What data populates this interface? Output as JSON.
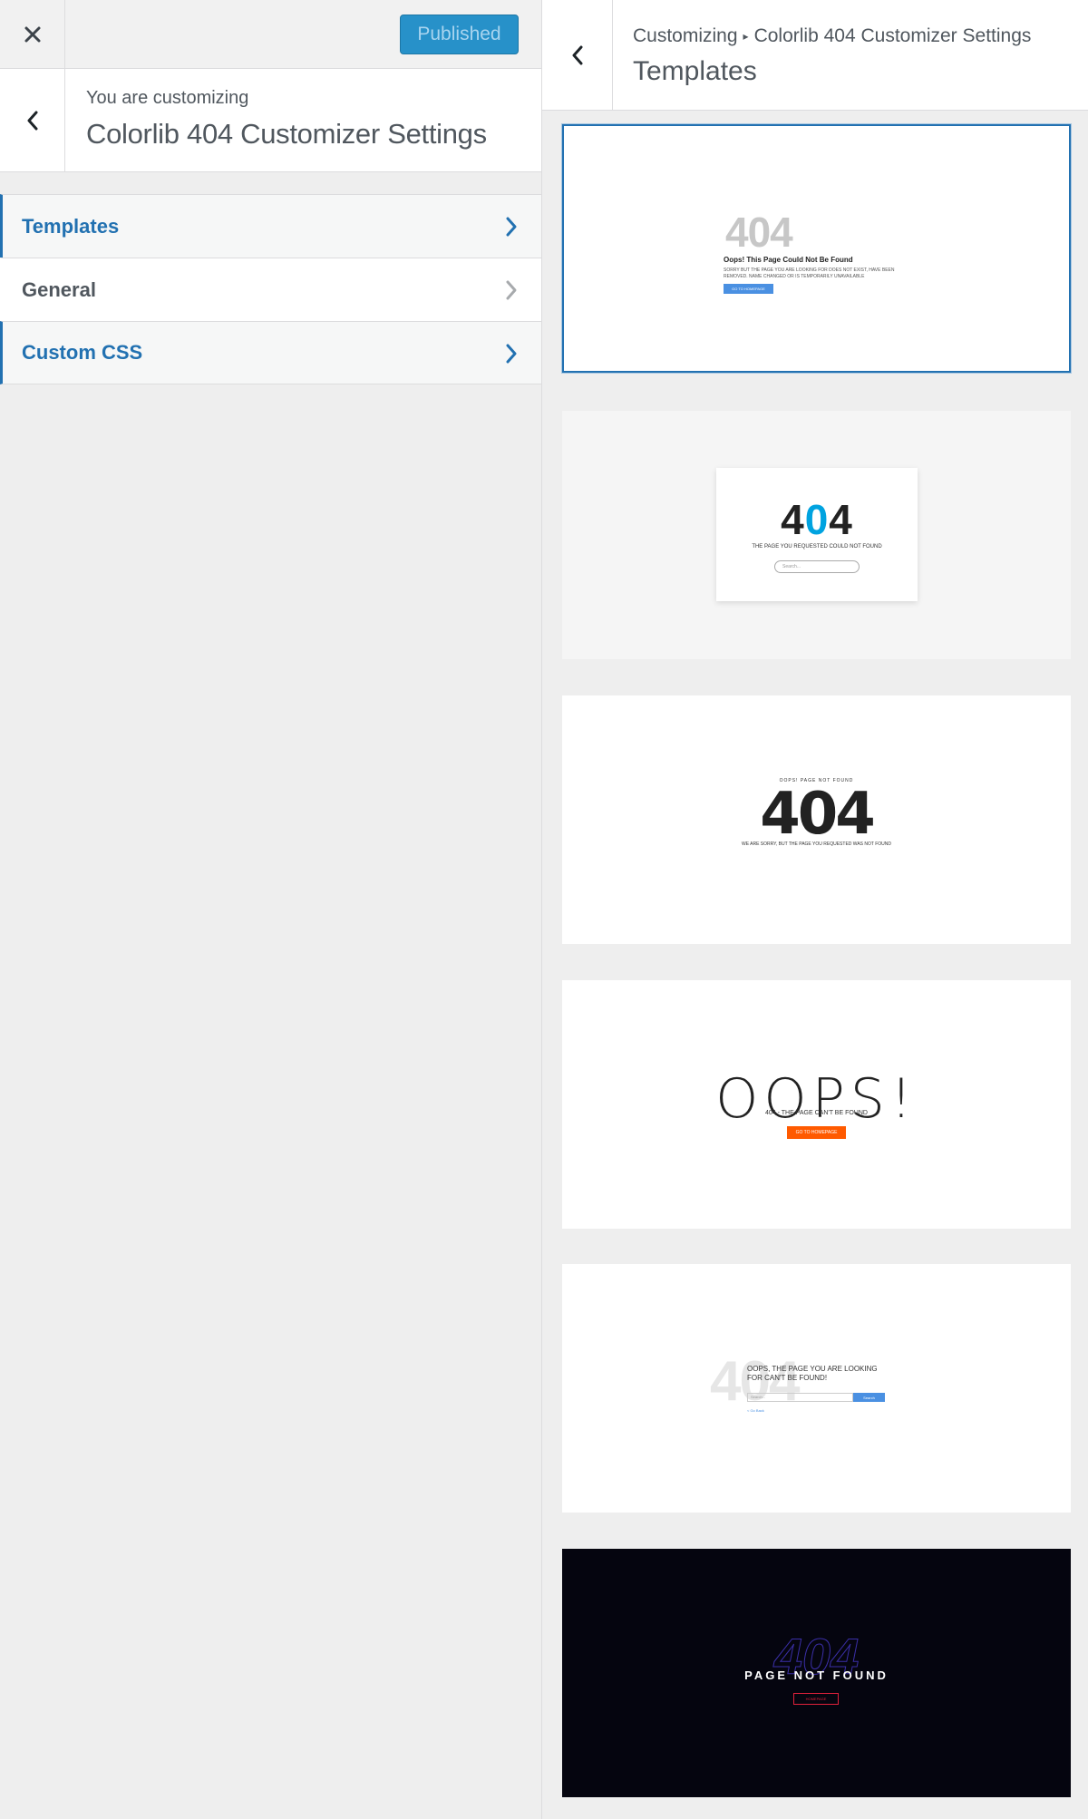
{
  "left_panel": {
    "published_label": "Published",
    "customizing_label": "You are customizing",
    "panel_title": "Colorlib 404 Customizer Settings",
    "menu": [
      {
        "label": "Templates"
      },
      {
        "label": "General"
      },
      {
        "label": "Custom CSS"
      }
    ]
  },
  "right_panel": {
    "breadcrumb_root": "Customizing",
    "breadcrumb_separator": "▸",
    "breadcrumb_current": "Colorlib 404 Customizer Settings",
    "section_title": "Templates"
  },
  "templates": [
    {
      "code": "404",
      "heading": "Oops! This Page Could Not Be Found",
      "body": "SORRY BUT THE PAGE YOU ARE LOOKING FOR DOES NOT EXIST, HAVE BEEN REMOVED. NAME CHANGED OR IS TEMPORARILY UNAVAILABLE",
      "button": "GO TO HOMEPAGE"
    },
    {
      "code_a": "4",
      "code_b": "0",
      "code_c": "4",
      "text": "THE PAGE YOU REQUESTED COULD NOT FOUND",
      "search_placeholder": "Search..."
    },
    {
      "top": "OOPS! PAGE NOT FOUND",
      "code": "404",
      "text": "WE ARE SORRY, BUT THE PAGE YOU REQUESTED WAS NOT FOUND"
    },
    {
      "heading": "OOPS!",
      "sub": "404 - THE PAGE CAN'T BE FOUND",
      "button": "GO TO HOMEPAGE"
    },
    {
      "code": "404",
      "heading": "OOPS, THE PAGE YOU ARE LOOKING FOR CAN'T BE FOUND!",
      "search_placeholder": "Search...",
      "button": "Search",
      "link": "< Go Back"
    },
    {
      "code": "404",
      "text": "PAGE NOT FOUND",
      "button": "HOMEPAGE"
    }
  ],
  "colors": {
    "accent": "#2271b1",
    "published_bg": "#2791c9",
    "t2_blue": "#00a3e0",
    "t4_orange": "#ff5a00",
    "t6_red": "#e0213b",
    "t6_bg": "#05050f"
  }
}
